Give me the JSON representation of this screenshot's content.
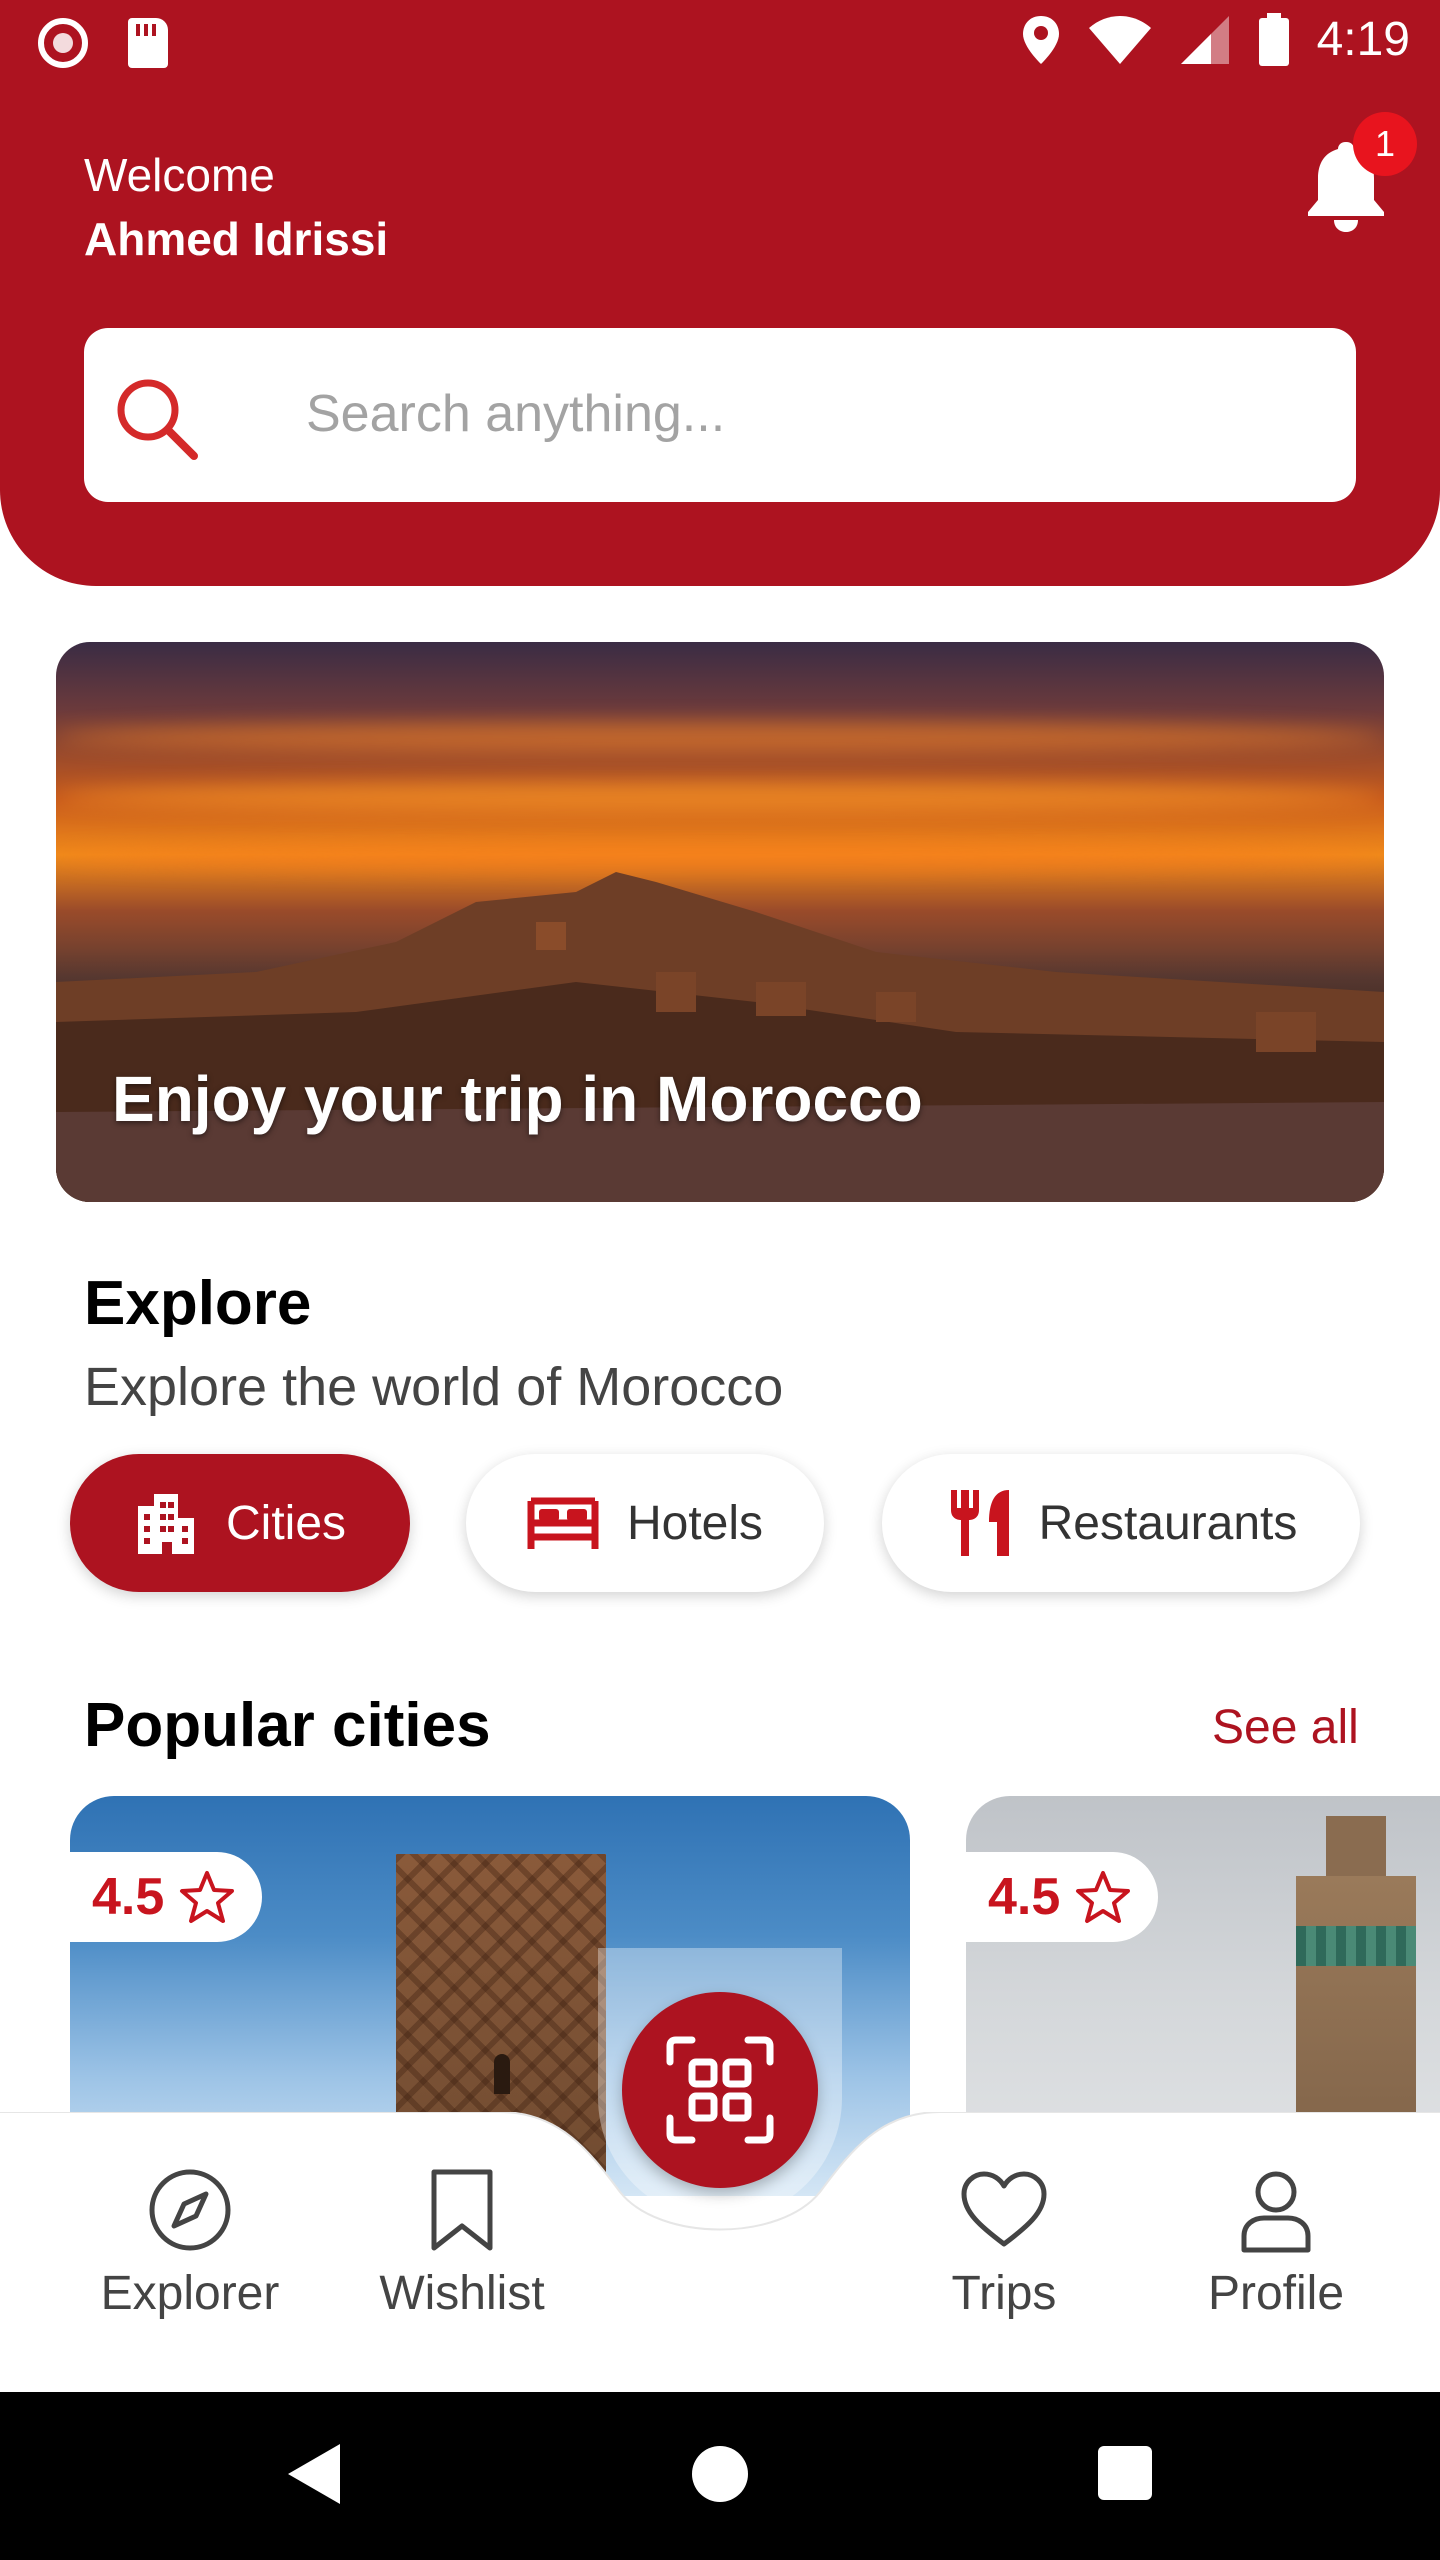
{
  "status_bar": {
    "time": "4:19"
  },
  "header": {
    "welcome": "Welcome",
    "user_name": "Ahmed Idrissi",
    "notification_count": "1"
  },
  "search": {
    "placeholder": "Search anything..."
  },
  "hero": {
    "title": "Enjoy your trip in Morocco"
  },
  "explore": {
    "title": "Explore",
    "subtitle": "Explore the world of Morocco",
    "chips": [
      {
        "label": "Cities",
        "icon": "city-icon",
        "selected": true
      },
      {
        "label": "Hotels",
        "icon": "bed-icon",
        "selected": false
      },
      {
        "label": "Restaurants",
        "icon": "restaurant-icon",
        "selected": false
      }
    ]
  },
  "popular": {
    "title": "Popular cities",
    "see_all": "See all",
    "cards": [
      {
        "rating": "4.5"
      },
      {
        "rating": "4.5"
      }
    ]
  },
  "bottom_nav": {
    "items": [
      {
        "label": "Explorer",
        "icon": "compass-icon"
      },
      {
        "label": "Wishlist",
        "icon": "bookmark-icon"
      },
      {
        "label": "Trips",
        "icon": "heart-icon"
      },
      {
        "label": "Profile",
        "icon": "user-icon"
      }
    ],
    "fab_icon": "qr-scan-icon"
  },
  "colors": {
    "primary": "#ad1320",
    "badge": "#e8141e",
    "text_muted": "#444444"
  }
}
